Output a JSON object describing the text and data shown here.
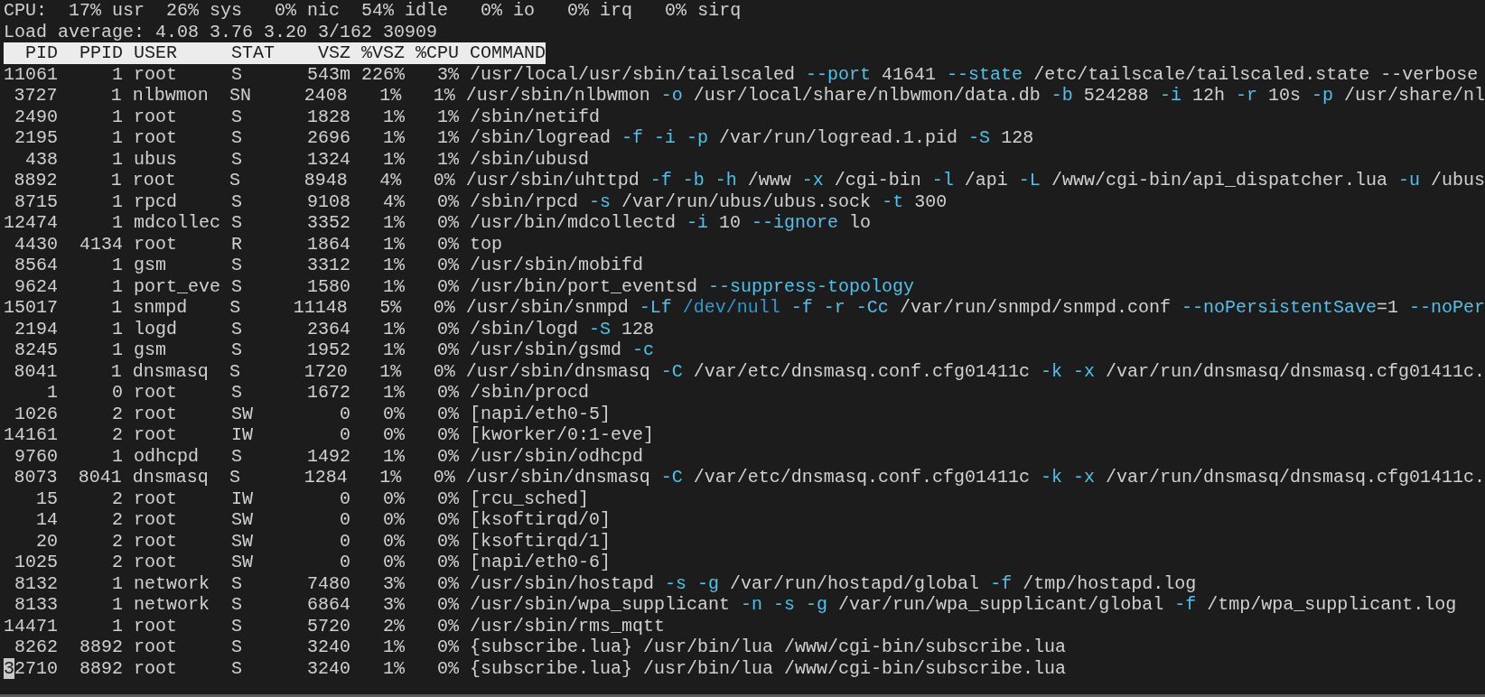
{
  "summary": {
    "cpu_line": "CPU:  17% usr  26% sys   0% nic  54% idle   0% io   0% irq   0% sirq",
    "load_line": "Load average: 4.08 3.76 3.20 3/162 30909"
  },
  "columns": [
    "PID",
    "PPID",
    "USER",
    "STAT",
    "VSZ",
    "%VSZ",
    "%CPU",
    "COMMAND"
  ],
  "rows": [
    {
      "pid": "11061",
      "ppid": "1",
      "user": "root",
      "stat": "S",
      "vsz": "543m",
      "vsz_pct": "226%",
      "cpu_pct": "3%",
      "cursor": false,
      "command": [
        {
          "kind": "text",
          "text": "/usr/local/usr/sbin/tailscaled "
        },
        {
          "kind": "flag",
          "text": "--port"
        },
        {
          "kind": "text",
          "text": " 41641 "
        },
        {
          "kind": "flag",
          "text": "--state"
        },
        {
          "kind": "text",
          "text": " /etc/tailscale/tailscaled.state --verbose"
        }
      ]
    },
    {
      "pid": "3727",
      "ppid": "1",
      "user": "nlbwmon",
      "stat": "SN",
      "vsz": "2408",
      "vsz_pct": "1%",
      "cpu_pct": "1%",
      "cursor": false,
      "command": [
        {
          "kind": "text",
          "text": "/usr/sbin/nlbwmon "
        },
        {
          "kind": "flag",
          "text": "-o"
        },
        {
          "kind": "text",
          "text": " /usr/local/share/nlbwmon/data.db "
        },
        {
          "kind": "flag",
          "text": "-b"
        },
        {
          "kind": "text",
          "text": " 524288 "
        },
        {
          "kind": "flag",
          "text": "-i"
        },
        {
          "kind": "text",
          "text": " 12h "
        },
        {
          "kind": "flag",
          "text": "-r"
        },
        {
          "kind": "text",
          "text": " 10s "
        },
        {
          "kind": "flag",
          "text": "-p"
        },
        {
          "kind": "text",
          "text": " /usr/share/nl"
        }
      ]
    },
    {
      "pid": "2490",
      "ppid": "1",
      "user": "root",
      "stat": "S",
      "vsz": "1828",
      "vsz_pct": "1%",
      "cpu_pct": "1%",
      "cursor": false,
      "command": [
        {
          "kind": "text",
          "text": "/sbin/netifd"
        }
      ]
    },
    {
      "pid": "2195",
      "ppid": "1",
      "user": "root",
      "stat": "S",
      "vsz": "2696",
      "vsz_pct": "1%",
      "cpu_pct": "1%",
      "cursor": false,
      "command": [
        {
          "kind": "text",
          "text": "/sbin/logread "
        },
        {
          "kind": "flag",
          "text": "-f -i -p"
        },
        {
          "kind": "text",
          "text": " /var/run/logread.1.pid "
        },
        {
          "kind": "flag",
          "text": "-S"
        },
        {
          "kind": "text",
          "text": " 128"
        }
      ]
    },
    {
      "pid": "438",
      "ppid": "1",
      "user": "ubus",
      "stat": "S",
      "vsz": "1324",
      "vsz_pct": "1%",
      "cpu_pct": "1%",
      "cursor": false,
      "command": [
        {
          "kind": "text",
          "text": "/sbin/ubusd"
        }
      ]
    },
    {
      "pid": "8892",
      "ppid": "1",
      "user": "root",
      "stat": "S",
      "vsz": "8948",
      "vsz_pct": "4%",
      "cpu_pct": "0%",
      "cursor": false,
      "command": [
        {
          "kind": "text",
          "text": "/usr/sbin/uhttpd "
        },
        {
          "kind": "flag",
          "text": "-f -b -h"
        },
        {
          "kind": "text",
          "text": " /www "
        },
        {
          "kind": "flag",
          "text": "-x"
        },
        {
          "kind": "text",
          "text": " /cgi-bin "
        },
        {
          "kind": "flag",
          "text": "-l"
        },
        {
          "kind": "text",
          "text": " /api "
        },
        {
          "kind": "flag",
          "text": "-L"
        },
        {
          "kind": "text",
          "text": " /www/cgi-bin/api_dispatcher.lua "
        },
        {
          "kind": "flag",
          "text": "-u"
        },
        {
          "kind": "text",
          "text": " /ubus"
        }
      ]
    },
    {
      "pid": "8715",
      "ppid": "1",
      "user": "rpcd",
      "stat": "S",
      "vsz": "9108",
      "vsz_pct": "4%",
      "cpu_pct": "0%",
      "cursor": false,
      "command": [
        {
          "kind": "text",
          "text": "/sbin/rpcd "
        },
        {
          "kind": "flag",
          "text": "-s"
        },
        {
          "kind": "text",
          "text": " /var/run/ubus/ubus.sock "
        },
        {
          "kind": "flag",
          "text": "-t"
        },
        {
          "kind": "text",
          "text": " 300"
        }
      ]
    },
    {
      "pid": "12474",
      "ppid": "1",
      "user": "mdcollec",
      "stat": "S",
      "vsz": "3352",
      "vsz_pct": "1%",
      "cpu_pct": "0%",
      "cursor": false,
      "command": [
        {
          "kind": "text",
          "text": "/usr/bin/mdcollectd "
        },
        {
          "kind": "flag",
          "text": "-i"
        },
        {
          "kind": "text",
          "text": " 10 "
        },
        {
          "kind": "flag",
          "text": "--ignore"
        },
        {
          "kind": "text",
          "text": " lo"
        }
      ]
    },
    {
      "pid": "4430",
      "ppid": "4134",
      "user": "root",
      "stat": "R",
      "vsz": "1864",
      "vsz_pct": "1%",
      "cpu_pct": "0%",
      "cursor": false,
      "command": [
        {
          "kind": "text",
          "text": "top"
        }
      ]
    },
    {
      "pid": "8564",
      "ppid": "1",
      "user": "gsm",
      "stat": "S",
      "vsz": "3312",
      "vsz_pct": "1%",
      "cpu_pct": "0%",
      "cursor": false,
      "command": [
        {
          "kind": "text",
          "text": "/usr/sbin/mobifd"
        }
      ]
    },
    {
      "pid": "9624",
      "ppid": "1",
      "user": "port_eve",
      "stat": "S",
      "vsz": "1580",
      "vsz_pct": "1%",
      "cpu_pct": "0%",
      "cursor": false,
      "command": [
        {
          "kind": "text",
          "text": "/usr/bin/port_eventsd "
        },
        {
          "kind": "flag",
          "text": "--suppress-topology"
        }
      ]
    },
    {
      "pid": "15017",
      "ppid": "1",
      "user": "snmpd",
      "stat": "S",
      "vsz": "11148",
      "vsz_pct": "5%",
      "cpu_pct": "0%",
      "cursor": false,
      "command": [
        {
          "kind": "text",
          "text": "/usr/sbin/snmpd "
        },
        {
          "kind": "flag",
          "text": "-Lf "
        },
        {
          "kind": "special",
          "text": "/dev/null"
        },
        {
          "kind": "flag",
          "text": " -f -r -Cc"
        },
        {
          "kind": "text",
          "text": " /var/run/snmpd/snmpd.conf "
        },
        {
          "kind": "flag",
          "text": "--noPersistentSave"
        },
        {
          "kind": "text",
          "text": "=1 "
        },
        {
          "kind": "flag",
          "text": "--noPer"
        }
      ]
    },
    {
      "pid": "2194",
      "ppid": "1",
      "user": "logd",
      "stat": "S",
      "vsz": "2364",
      "vsz_pct": "1%",
      "cpu_pct": "0%",
      "cursor": false,
      "command": [
        {
          "kind": "text",
          "text": "/sbin/logd "
        },
        {
          "kind": "flag",
          "text": "-S"
        },
        {
          "kind": "text",
          "text": " 128"
        }
      ]
    },
    {
      "pid": "8245",
      "ppid": "1",
      "user": "gsm",
      "stat": "S",
      "vsz": "1952",
      "vsz_pct": "1%",
      "cpu_pct": "0%",
      "cursor": false,
      "command": [
        {
          "kind": "text",
          "text": "/usr/sbin/gsmd "
        },
        {
          "kind": "flag",
          "text": "-c"
        }
      ]
    },
    {
      "pid": "8041",
      "ppid": "1",
      "user": "dnsmasq",
      "stat": "S",
      "vsz": "1720",
      "vsz_pct": "1%",
      "cpu_pct": "0%",
      "cursor": false,
      "command": [
        {
          "kind": "text",
          "text": "/usr/sbin/dnsmasq "
        },
        {
          "kind": "flag",
          "text": "-C"
        },
        {
          "kind": "text",
          "text": " /var/etc/dnsmasq.conf.cfg01411c "
        },
        {
          "kind": "flag",
          "text": "-k -x"
        },
        {
          "kind": "text",
          "text": " /var/run/dnsmasq/dnsmasq.cfg01411c."
        }
      ]
    },
    {
      "pid": "1",
      "ppid": "0",
      "user": "root",
      "stat": "S",
      "vsz": "1672",
      "vsz_pct": "1%",
      "cpu_pct": "0%",
      "cursor": false,
      "command": [
        {
          "kind": "text",
          "text": "/sbin/procd"
        }
      ]
    },
    {
      "pid": "1026",
      "ppid": "2",
      "user": "root",
      "stat": "SW",
      "vsz": "0",
      "vsz_pct": "0%",
      "cpu_pct": "0%",
      "cursor": false,
      "command": [
        {
          "kind": "text",
          "text": "[napi/eth0-5]"
        }
      ]
    },
    {
      "pid": "14161",
      "ppid": "2",
      "user": "root",
      "stat": "IW",
      "vsz": "0",
      "vsz_pct": "0%",
      "cpu_pct": "0%",
      "cursor": false,
      "command": [
        {
          "kind": "text",
          "text": "[kworker/0:1-eve]"
        }
      ]
    },
    {
      "pid": "9760",
      "ppid": "1",
      "user": "odhcpd",
      "stat": "S",
      "vsz": "1492",
      "vsz_pct": "1%",
      "cpu_pct": "0%",
      "cursor": false,
      "command": [
        {
          "kind": "text",
          "text": "/usr/sbin/odhcpd"
        }
      ]
    },
    {
      "pid": "8073",
      "ppid": "8041",
      "user": "dnsmasq",
      "stat": "S",
      "vsz": "1284",
      "vsz_pct": "1%",
      "cpu_pct": "0%",
      "cursor": false,
      "command": [
        {
          "kind": "text",
          "text": "/usr/sbin/dnsmasq "
        },
        {
          "kind": "flag",
          "text": "-C"
        },
        {
          "kind": "text",
          "text": " /var/etc/dnsmasq.conf.cfg01411c "
        },
        {
          "kind": "flag",
          "text": "-k -x"
        },
        {
          "kind": "text",
          "text": " /var/run/dnsmasq/dnsmasq.cfg01411c."
        }
      ]
    },
    {
      "pid": "15",
      "ppid": "2",
      "user": "root",
      "stat": "IW",
      "vsz": "0",
      "vsz_pct": "0%",
      "cpu_pct": "0%",
      "cursor": false,
      "command": [
        {
          "kind": "text",
          "text": "[rcu_sched]"
        }
      ]
    },
    {
      "pid": "14",
      "ppid": "2",
      "user": "root",
      "stat": "SW",
      "vsz": "0",
      "vsz_pct": "0%",
      "cpu_pct": "0%",
      "cursor": false,
      "command": [
        {
          "kind": "text",
          "text": "[ksoftirqd/0]"
        }
      ]
    },
    {
      "pid": "20",
      "ppid": "2",
      "user": "root",
      "stat": "SW",
      "vsz": "0",
      "vsz_pct": "0%",
      "cpu_pct": "0%",
      "cursor": false,
      "command": [
        {
          "kind": "text",
          "text": "[ksoftirqd/1]"
        }
      ]
    },
    {
      "pid": "1025",
      "ppid": "2",
      "user": "root",
      "stat": "SW",
      "vsz": "0",
      "vsz_pct": "0%",
      "cpu_pct": "0%",
      "cursor": false,
      "command": [
        {
          "kind": "text",
          "text": "[napi/eth0-6]"
        }
      ]
    },
    {
      "pid": "8132",
      "ppid": "1",
      "user": "network",
      "stat": "S",
      "vsz": "7480",
      "vsz_pct": "3%",
      "cpu_pct": "0%",
      "cursor": false,
      "command": [
        {
          "kind": "text",
          "text": "/usr/sbin/hostapd "
        },
        {
          "kind": "flag",
          "text": "-s -g"
        },
        {
          "kind": "text",
          "text": " /var/run/hostapd/global "
        },
        {
          "kind": "flag",
          "text": "-f"
        },
        {
          "kind": "text",
          "text": " /tmp/hostapd.log"
        }
      ]
    },
    {
      "pid": "8133",
      "ppid": "1",
      "user": "network",
      "stat": "S",
      "vsz": "6864",
      "vsz_pct": "3%",
      "cpu_pct": "0%",
      "cursor": false,
      "command": [
        {
          "kind": "text",
          "text": "/usr/sbin/wpa_supplicant "
        },
        {
          "kind": "flag",
          "text": "-n -s -g"
        },
        {
          "kind": "text",
          "text": " /var/run/wpa_supplicant/global "
        },
        {
          "kind": "flag",
          "text": "-f"
        },
        {
          "kind": "text",
          "text": " /tmp/wpa_supplicant.log"
        }
      ]
    },
    {
      "pid": "14471",
      "ppid": "1",
      "user": "root",
      "stat": "S",
      "vsz": "5720",
      "vsz_pct": "2%",
      "cpu_pct": "0%",
      "cursor": false,
      "command": [
        {
          "kind": "text",
          "text": "/usr/sbin/rms_mqtt"
        }
      ]
    },
    {
      "pid": "8262",
      "ppid": "8892",
      "user": "root",
      "stat": "S",
      "vsz": "3240",
      "vsz_pct": "1%",
      "cpu_pct": "0%",
      "cursor": false,
      "command": [
        {
          "kind": "text",
          "text": "{subscribe.lua} /usr/bin/lua /www/cgi-bin/subscribe.lua"
        }
      ]
    },
    {
      "pid": "32710",
      "ppid": "8892",
      "user": "root",
      "stat": "S",
      "vsz": "3240",
      "vsz_pct": "1%",
      "cpu_pct": "0%",
      "cursor": true,
      "command": [
        {
          "kind": "text",
          "text": "{subscribe.lua} /usr/bin/lua /www/cgi-bin/subscribe.lua"
        }
      ]
    }
  ]
}
